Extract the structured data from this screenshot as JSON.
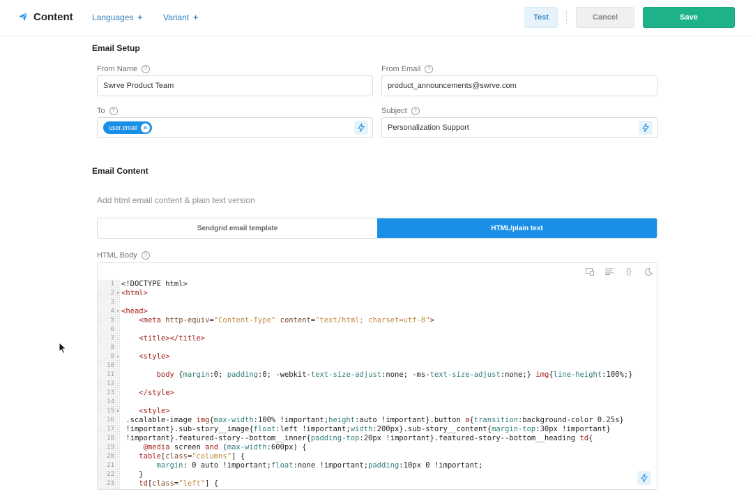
{
  "header": {
    "title": "Content",
    "languages_label": "Languages",
    "variant_label": "Variant",
    "test_label": "Test",
    "cancel_label": "Cancel",
    "save_label": "Save",
    "logo_icon": "paper-plane-icon"
  },
  "email_setup": {
    "heading": "Email Setup",
    "from_name": {
      "label": "From Name",
      "value": "Swrve Product Team"
    },
    "from_email": {
      "label": "From Email",
      "value": "product_announcements@swrve.com"
    },
    "to": {
      "label": "To",
      "chip": "user.email"
    },
    "subject": {
      "label": "Subject",
      "value": "Personalization Support"
    }
  },
  "email_content": {
    "heading": "Email Content",
    "hint": "Add html email content & plain text version",
    "tabs": [
      "Sendgrid email template",
      "HTML/plain text"
    ],
    "active_tab": 1,
    "html_body_label": "HTML Body"
  },
  "colors": {
    "accent": "#1a8fe8",
    "save": "#1db28a"
  },
  "code_lines": [
    {
      "n": "1",
      "fold": "",
      "html": "<span>&lt;!DOCTYPE html&gt;</span>"
    },
    {
      "n": "2",
      "fold": "▾",
      "html": "<span class='t-tag'>&lt;html&gt;</span>"
    },
    {
      "n": "3",
      "fold": "",
      "html": ""
    },
    {
      "n": "4",
      "fold": "▾",
      "html": "<span class='t-tag'>&lt;head&gt;</span>"
    },
    {
      "n": "5",
      "fold": "",
      "html": "    <span class='t-tag'>&lt;meta</span> <span class='t-attr'>http-equiv</span>=<span class='t-str'>\"Content-Type\"</span> <span class='t-attr'>content</span>=<span class='t-str'>\"text/html; charset=utf-8\"</span><span class='t-tag'>&gt;</span>"
    },
    {
      "n": "6",
      "fold": "",
      "html": ""
    },
    {
      "n": "7",
      "fold": "",
      "html": "    <span class='t-tag'>&lt;title&gt;&lt;/title&gt;</span>"
    },
    {
      "n": "8",
      "fold": "",
      "html": ""
    },
    {
      "n": "9",
      "fold": "▾",
      "html": "    <span class='t-tag'>&lt;style&gt;</span>"
    },
    {
      "n": "10",
      "fold": "",
      "html": ""
    },
    {
      "n": "11",
      "fold": "",
      "html": "        <span class='t-tag'>body</span> {<span class='t-prop'>margin</span>:0; <span class='t-prop'>padding</span>:0; -webkit-<span class='t-prop'>text-size-adjust</span>:none; -ms-<span class='t-prop'>text-size-adjust</span>:none;} <span class='t-tag'>img</span>{<span class='t-prop'>line-height</span>:100%;}"
    },
    {
      "n": "12",
      "fold": "",
      "html": ""
    },
    {
      "n": "13",
      "fold": "",
      "html": "    <span class='t-tag'>&lt;/style&gt;</span>"
    },
    {
      "n": "14",
      "fold": "",
      "html": ""
    },
    {
      "n": "15",
      "fold": "▾",
      "html": "    <span class='t-tag'>&lt;style&gt;</span>"
    },
    {
      "n": "16",
      "fold": "",
      "html": " .scalable-image <span class='t-tag'>img</span>{<span class='t-prop'>max-width</span>:100% !important;<span class='t-prop'>height</span>:auto !important}.button <span class='t-tag'>a</span>{<span class='t-prop'>transition</span>:background-color 0.25s}"
    },
    {
      "n": "17",
      "fold": "",
      "html": " !important}.sub-story__image{<span class='t-prop'>float</span>:left !important;<span class='t-prop'>width</span>:200px}.sub-story__content{<span class='t-prop'>margin-top</span>:30px !important}"
    },
    {
      "n": "18",
      "fold": "",
      "html": " !important}.featured-story--bottom__inner{<span class='t-prop'>padding-top</span>:20px !important}.featured-story--bottom__heading <span class='t-tag'>td</span>{"
    },
    {
      "n": "19",
      "fold": "",
      "html": "     <span class='t-tag'>@media</span> screen <span class='t-tag'>and</span> (<span class='t-prop'>max-width</span>:600px) {"
    },
    {
      "n": "20",
      "fold": "",
      "html": "    <span class='t-tag'>table</span>[<span class='t-attr'>class</span>=<span class='t-str'>\"columns\"</span>] {"
    },
    {
      "n": "21",
      "fold": "",
      "html": "        <span class='t-prop'>margin</span>: 0 auto !important;<span class='t-prop'>float</span>:none !important;<span class='t-prop'>padding</span>:10px 0 !important;"
    },
    {
      "n": "22",
      "fold": "",
      "html": "    }"
    },
    {
      "n": "23",
      "fold": "",
      "html": "    <span class='t-tag'>td</span>[<span class='t-attr'>class</span>=<span class='t-str'>\"left\"</span>] {"
    }
  ]
}
